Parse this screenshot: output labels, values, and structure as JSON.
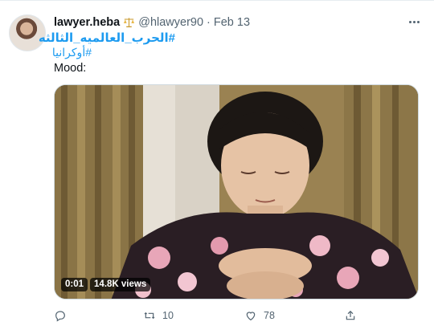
{
  "tweet": {
    "display_name": "lawyer.heba",
    "badge_icon": "scales-of-justice-icon",
    "handle": "@hlawyer90",
    "separator": "·",
    "date": "Feb 13",
    "hashtag_line1": "#الحرب_العالميه_الثالثه",
    "hashtag_line2": "#أوكرانيا",
    "text": "Mood:",
    "media": {
      "type": "video",
      "duration": "0:01",
      "views": "14.8K views"
    },
    "actions": {
      "reply_count": "",
      "retweet_count": "10",
      "like_count": "78"
    }
  },
  "colors": {
    "link": "#1d9bf0",
    "secondary_text": "#536471",
    "primary_text": "#0f1419"
  }
}
